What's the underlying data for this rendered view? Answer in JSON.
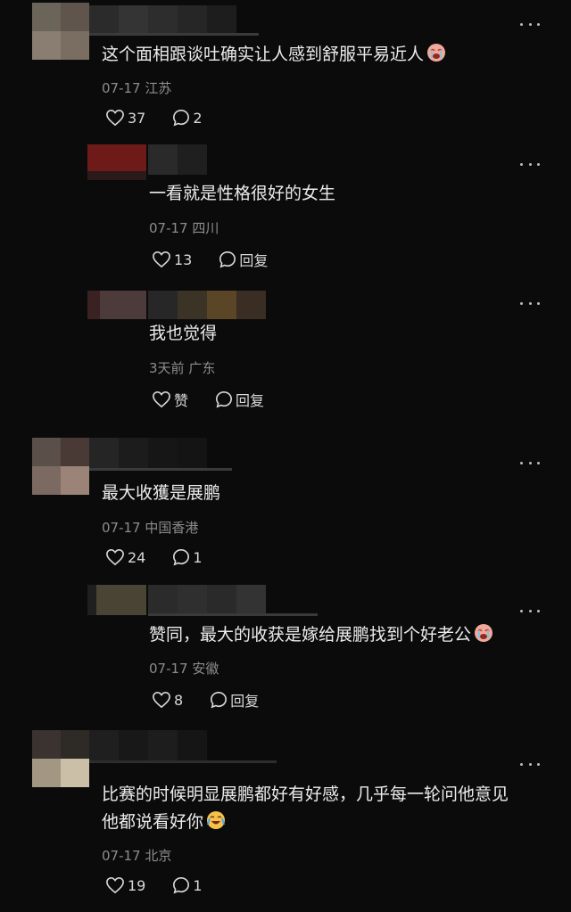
{
  "comments": [
    {
      "text": "这个面相跟谈吐确实让人感到舒服平易近人",
      "emoji": "ugly-crying-face",
      "date": "07-17",
      "location": "江苏",
      "likes": "37",
      "replies": "2"
    },
    {
      "text": "一看就是性格很好的女生",
      "date": "07-17",
      "location": "四川",
      "likes": "13",
      "reply_label": "回复"
    },
    {
      "text": "我也觉得",
      "date": "3天前",
      "location": "广东",
      "likes": "赞",
      "reply_label": "回复"
    },
    {
      "text": "最大收獲是展鹏",
      "date": "07-17",
      "location": "中国香港",
      "likes": "24",
      "replies": "1"
    },
    {
      "text": "赞同，最大的收获是嫁给展鹏找到个好老公",
      "emoji": "ugly-crying-face",
      "date": "07-17",
      "location": "安徽",
      "likes": "8",
      "reply_label": "回复"
    },
    {
      "text_line1": "比赛的时候明显展鹏都好有好感，几乎每一轮问他意见",
      "text_line2": "他都说看好你",
      "emoji": "crying-laughing-face",
      "date": "07-17",
      "location": "北京",
      "likes": "19",
      "replies": "1"
    }
  ],
  "icons": {
    "like": "heart-outline-icon",
    "comment": "speech-bubble-icon",
    "more": "more-dots-icon"
  },
  "colors": {
    "background": "#0b0b0b",
    "text": "#ececec",
    "meta": "#8d8d8d",
    "icon": "#d8d8d8"
  }
}
